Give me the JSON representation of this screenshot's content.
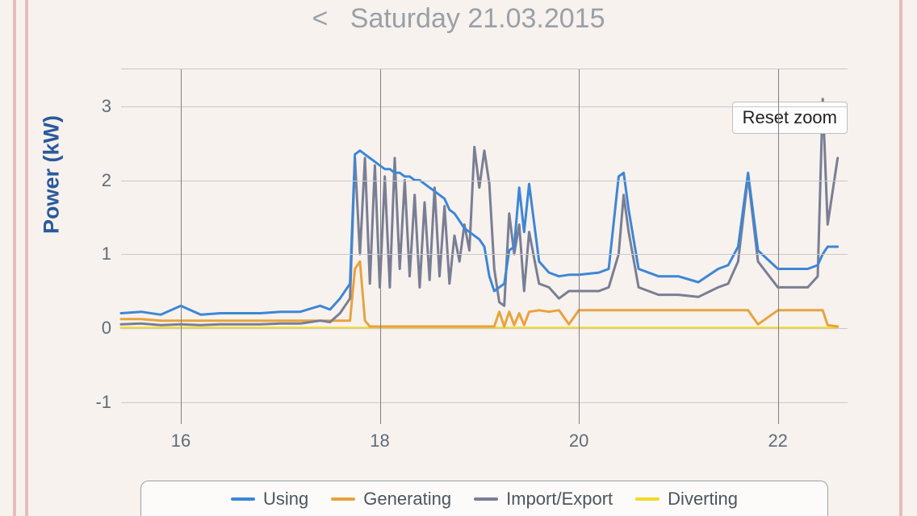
{
  "header": {
    "prev_symbol": "<",
    "date_label": "Saturday 21.03.2015"
  },
  "buttons": {
    "reset_zoom": "Reset zoom"
  },
  "axis": {
    "ylabel": "Power (kW)"
  },
  "legend": {
    "using": "Using",
    "generating": "Generating",
    "import_export": "Import/Export",
    "diverting": "Diverting"
  },
  "colors": {
    "using": "#3d86d6",
    "generating": "#e8a33d",
    "import_export": "#7a7e94",
    "diverting": "#f2d92a",
    "grid": "#c9c9c9",
    "axis_text": "#5f6b77"
  },
  "chart_data": {
    "type": "line",
    "title": "",
    "xlabel": "",
    "ylabel": "Power (kW)",
    "xlim": [
      15.4,
      22.7
    ],
    "ylim": [
      -1.3,
      3.5
    ],
    "yticks": [
      -1,
      0,
      1,
      2,
      3
    ],
    "xticks": [
      16,
      18,
      20,
      22
    ],
    "legend_position": "bottom",
    "grid": true,
    "x": [
      15.4,
      15.6,
      15.8,
      16.0,
      16.2,
      16.4,
      16.6,
      16.8,
      17.0,
      17.2,
      17.4,
      17.5,
      17.6,
      17.7,
      17.75,
      17.8,
      17.85,
      17.9,
      17.95,
      18.0,
      18.05,
      18.1,
      18.15,
      18.2,
      18.25,
      18.3,
      18.35,
      18.4,
      18.45,
      18.5,
      18.55,
      18.6,
      18.65,
      18.7,
      18.75,
      18.8,
      18.85,
      18.9,
      18.95,
      19.0,
      19.05,
      19.1,
      19.15,
      19.2,
      19.25,
      19.3,
      19.35,
      19.4,
      19.45,
      19.5,
      19.6,
      19.7,
      19.8,
      19.9,
      20.0,
      20.2,
      20.3,
      20.4,
      20.45,
      20.5,
      20.6,
      20.8,
      21.0,
      21.2,
      21.4,
      21.5,
      21.6,
      21.7,
      21.8,
      22.0,
      22.2,
      22.3,
      22.4,
      22.45,
      22.5,
      22.6
    ],
    "series": [
      {
        "name": "Using",
        "color": "#3d86d6",
        "values": [
          0.2,
          0.22,
          0.18,
          0.3,
          0.18,
          0.2,
          0.2,
          0.2,
          0.22,
          0.22,
          0.3,
          0.25,
          0.4,
          0.6,
          2.35,
          2.4,
          2.35,
          2.3,
          2.25,
          2.2,
          2.15,
          2.15,
          2.1,
          2.1,
          2.05,
          2.05,
          2.0,
          2.0,
          1.95,
          1.9,
          1.85,
          1.8,
          1.75,
          1.6,
          1.55,
          1.45,
          1.35,
          1.3,
          1.25,
          1.2,
          1.1,
          0.7,
          0.5,
          0.55,
          0.6,
          1.05,
          1.1,
          1.9,
          1.3,
          1.95,
          0.9,
          0.75,
          0.7,
          0.72,
          0.72,
          0.75,
          0.8,
          2.05,
          2.1,
          1.6,
          0.8,
          0.7,
          0.7,
          0.62,
          0.8,
          0.85,
          1.1,
          2.1,
          1.05,
          0.8,
          0.8,
          0.8,
          0.85,
          1.0,
          1.1,
          1.1
        ]
      },
      {
        "name": "Generating",
        "color": "#e8a33d",
        "values": [
          0.12,
          0.12,
          0.1,
          0.1,
          0.1,
          0.1,
          0.1,
          0.1,
          0.1,
          0.1,
          0.1,
          0.1,
          0.1,
          0.1,
          0.8,
          0.9,
          0.1,
          0.02,
          0.02,
          0.02,
          0.02,
          0.02,
          0.02,
          0.02,
          0.02,
          0.02,
          0.02,
          0.02,
          0.02,
          0.02,
          0.02,
          0.02,
          0.02,
          0.02,
          0.02,
          0.02,
          0.02,
          0.02,
          0.02,
          0.02,
          0.02,
          0.02,
          0.02,
          0.22,
          0.02,
          0.22,
          0.04,
          0.2,
          0.04,
          0.22,
          0.24,
          0.22,
          0.24,
          0.05,
          0.24,
          0.24,
          0.24,
          0.24,
          0.24,
          0.24,
          0.24,
          0.24,
          0.24,
          0.24,
          0.24,
          0.24,
          0.24,
          0.24,
          0.05,
          0.24,
          0.24,
          0.24,
          0.24,
          0.24,
          0.04,
          0.02
        ]
      },
      {
        "name": "Import/Export",
        "color": "#7a7e94",
        "values": [
          0.05,
          0.06,
          0.04,
          0.05,
          0.04,
          0.05,
          0.05,
          0.05,
          0.06,
          0.06,
          0.1,
          0.08,
          0.2,
          0.4,
          2.3,
          1.0,
          2.3,
          0.6,
          2.2,
          0.55,
          2.05,
          0.55,
          2.3,
          0.8,
          2.0,
          0.7,
          1.8,
          0.55,
          1.7,
          0.65,
          1.9,
          0.7,
          1.65,
          0.6,
          1.25,
          0.9,
          1.4,
          1.05,
          2.45,
          1.9,
          2.4,
          1.95,
          0.8,
          0.35,
          0.3,
          1.55,
          1.0,
          1.4,
          0.5,
          1.3,
          0.6,
          0.55,
          0.4,
          0.5,
          0.5,
          0.5,
          0.55,
          1.0,
          1.8,
          1.3,
          0.55,
          0.45,
          0.45,
          0.42,
          0.55,
          0.6,
          0.9,
          2.05,
          0.9,
          0.55,
          0.55,
          0.55,
          0.7,
          3.1,
          1.4,
          2.3
        ]
      },
      {
        "name": "Diverting",
        "color": "#f2d92a",
        "values": [
          0.0,
          0.0,
          0.0,
          0.0,
          0.0,
          0.0,
          0.0,
          0.0,
          0.0,
          0.0,
          0.0,
          0.0,
          0.0,
          0.0,
          0.0,
          0.0,
          0.0,
          0.0,
          0.0,
          0.0,
          0.0,
          0.0,
          0.0,
          0.0,
          0.0,
          0.0,
          0.0,
          0.0,
          0.0,
          0.0,
          0.0,
          0.0,
          0.0,
          0.0,
          0.0,
          0.0,
          0.0,
          0.0,
          0.0,
          0.0,
          0.0,
          0.0,
          0.0,
          0.0,
          0.0,
          0.0,
          0.0,
          0.0,
          0.0,
          0.0,
          0.0,
          0.0,
          0.0,
          0.0,
          0.0,
          0.0,
          0.0,
          0.0,
          0.0,
          0.0,
          0.0,
          0.0,
          0.0,
          0.0,
          0.0,
          0.0,
          0.0,
          0.0,
          0.0,
          0.0,
          0.0,
          0.0,
          0.0,
          0.0,
          0.0,
          0.0
        ]
      }
    ]
  }
}
